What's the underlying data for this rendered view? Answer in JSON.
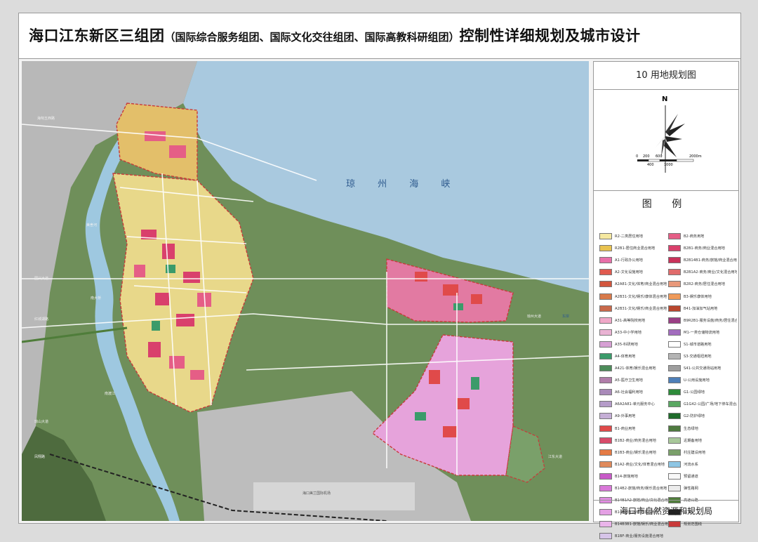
{
  "title": {
    "main": "海口江东新区三组团",
    "sub": "（国际综合服务组团、国际文化交往组团、国际高教科研组团）",
    "tail": "控制性详细规划及城市设计"
  },
  "panel": {
    "drawing_title": "10  用地规划图",
    "north_label": "N",
    "scale_labels": [
      "0",
      "200",
      "600",
      "2000m",
      "400",
      "1000"
    ],
    "legend_title": "图  例",
    "footer": "海口市自然资源和规划局"
  },
  "map": {
    "water_label": "琼  州  海  峡",
    "road_labels": [
      "海甸五西路",
      "美舍河",
      "国兴大道",
      "红城湖路",
      "南渡江",
      "琼山大道",
      "凤翔路",
      "南大桥",
      "琼州大道",
      "江东大道",
      "东岸",
      "海口美兰国际机场"
    ]
  },
  "legend": {
    "left": [
      {
        "label": "R2-二类居住用地",
        "color": "#f5e8a0"
      },
      {
        "label": "R2B1-居住商业混合用地",
        "color": "#e8c24f"
      },
      {
        "label": "A1-行政办公用地",
        "color": "#e76fa9"
      },
      {
        "label": "A2-文化设施用地",
        "color": "#e05a4f"
      },
      {
        "label": "A2A81-文化/体育/商业混合用地",
        "color": "#d2563d"
      },
      {
        "label": "A2B31-文化/娱乐/康体混合用地",
        "color": "#d87a4a"
      },
      {
        "label": "A2B31-文化/娱乐/商业混合用地",
        "color": "#c9694b"
      },
      {
        "label": "A31-高等院校用地",
        "color": "#f0a8c8"
      },
      {
        "label": "A33-中小学用地",
        "color": "#e9b3d3"
      },
      {
        "label": "A35-科研用地",
        "color": "#d7a0d4"
      },
      {
        "label": "A4-体育用地",
        "color": "#3b9b6a"
      },
      {
        "label": "A421-体育/娱乐混合用地",
        "color": "#4d8c5a"
      },
      {
        "label": "A5-医疗卫生用地",
        "color": "#b07da9"
      },
      {
        "label": "A6-社会福利用地",
        "color": "#a98ab9"
      },
      {
        "label": "A6A2A81-单元服务中心",
        "color": "#b59bc9"
      },
      {
        "label": "A9-外事用地",
        "color": "#c5aed6"
      },
      {
        "label": "B1-商业用地",
        "color": "#e04a4a"
      },
      {
        "label": "B1B2-商业/商务混合用地",
        "color": "#d84b6a"
      },
      {
        "label": "B1B3-商业/娱乐混合用地",
        "color": "#e57b45"
      },
      {
        "label": "B1A2-商业/文化/体育混合用地",
        "color": "#e08a5b"
      },
      {
        "label": "B14-旅馆用地",
        "color": "#c85ac8"
      },
      {
        "label": "B14B2-旅馆/商务/娱乐混合用地",
        "color": "#d978d9"
      },
      {
        "label": "B14B1A2-旅馆/商业/文化混合用地",
        "color": "#e08de0"
      },
      {
        "label": "B14B2-旅馆/商务混合用地",
        "color": "#e4a0e4"
      },
      {
        "label": "B14B3B1-旅馆/娱乐/商业混合用地",
        "color": "#eab4ea"
      },
      {
        "label": "B1BF-商业/服务设施混合用地",
        "color": "#d6c4e8"
      }
    ],
    "right": [
      {
        "label": "B2-商务用地",
        "color": "#e55e86"
      },
      {
        "label": "B2B1-商务/商业混合用地",
        "color": "#d9406c"
      },
      {
        "label": "B2B14B1-商务/旅馆/商业混合用地",
        "color": "#c9325a"
      },
      {
        "label": "B2B1A2-商务/商业/文化混合用地",
        "color": "#e06b6b"
      },
      {
        "label": "B2R2-商务/居住混合用地",
        "color": "#e8987a"
      },
      {
        "label": "B3-娱乐康体用地",
        "color": "#ef9a5a"
      },
      {
        "label": "B41-加油加气站用地",
        "color": "#b9472e"
      },
      {
        "label": "B9R2B1-服务设施/商务/居住混合用地",
        "color": "#9b3f85"
      },
      {
        "label": "M1-一类仓储物流用地",
        "color": "#a26cbe"
      },
      {
        "label": "S1-城市道路用地",
        "color": "#ffffff"
      },
      {
        "label": "S3-交通枢纽用地",
        "color": "#b4b4b4"
      },
      {
        "label": "S41-公共交通场站用地",
        "color": "#9e9e9e"
      },
      {
        "label": "U-公用设施用地",
        "color": "#4e7fb8"
      },
      {
        "label": "G1-公园绿地",
        "color": "#2e8b3a"
      },
      {
        "label": "G1G42-公园/广场/地下停车混合用地",
        "color": "#5aa862"
      },
      {
        "label": "G2-防护绿地",
        "color": "#1f6b2b"
      },
      {
        "label": "生态绿地",
        "color": "#4f7a3f"
      },
      {
        "label": "近期备用地",
        "color": "#a8c89a"
      },
      {
        "label": "村庄建设用地",
        "color": "#7aa06a"
      },
      {
        "label": "河流水系",
        "color": "#8ec6e4"
      },
      {
        "label": "预留通道",
        "color": "#f8f8f8"
      },
      {
        "label": "弹性路网",
        "color": "#ececec"
      },
      {
        "label": "高速公路",
        "color": "#4f7d3a"
      },
      {
        "label": "铁    路",
        "color": "#222222"
      },
      {
        "label": "规划范围线",
        "color": "#c83a3a"
      }
    ]
  }
}
